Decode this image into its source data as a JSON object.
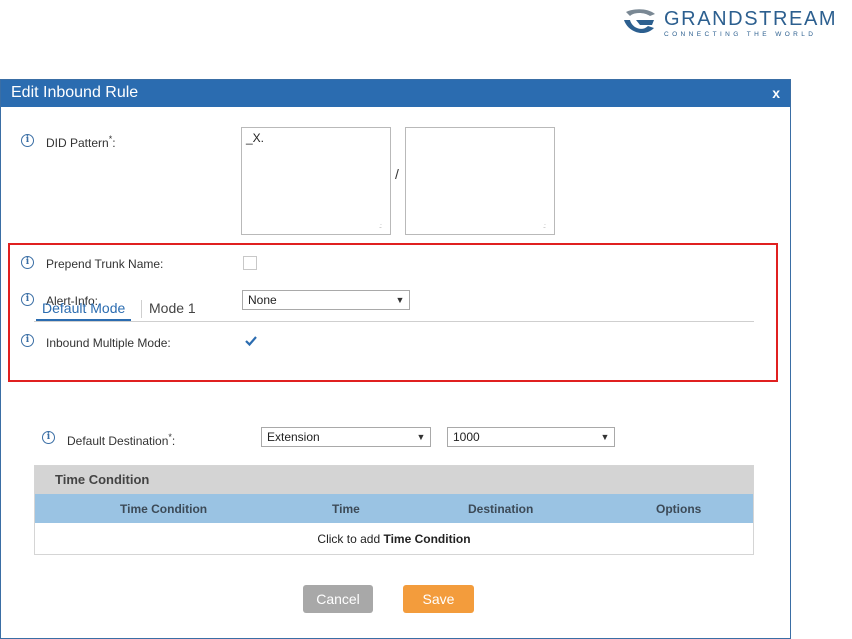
{
  "brand": {
    "name": "GRANDSTREAM",
    "tagline": "CONNECTING THE WORLD"
  },
  "dialog": {
    "title": "Edit Inbound Rule",
    "close_label": "x"
  },
  "form": {
    "did_pattern": {
      "label": "DID Pattern",
      "required_mark": "*",
      "colon": ":",
      "value": "_X.",
      "second_value": "",
      "separator": "/"
    },
    "prepend_trunk_name": {
      "label": "Prepend Trunk Name:",
      "checked": false
    },
    "alert_info": {
      "label": "Alert-Info:",
      "value": "None"
    },
    "inbound_multiple_mode": {
      "label": "Inbound Multiple Mode:",
      "checked": true
    },
    "tabs": [
      {
        "label": "Default Mode",
        "active": true
      },
      {
        "label": "Mode 1",
        "active": false
      }
    ],
    "default_destination": {
      "label": "Default Destination",
      "required_mark": "*",
      "colon": ":",
      "type_value": "Extension",
      "target_value": "1000"
    }
  },
  "time_condition": {
    "title": "Time Condition",
    "columns": [
      "Time Condition",
      "Time",
      "Destination",
      "Options"
    ],
    "add_prefix": "Click to add ",
    "add_bold": "Time Condition"
  },
  "buttons": {
    "cancel": "Cancel",
    "save": "Save"
  },
  "colors": {
    "titlebar": "#2b6cb0",
    "highlight_border": "#e02020",
    "save_button": "#f39c3c",
    "cancel_button": "#a8a8a8",
    "table_header": "#9ac3e3"
  },
  "icons": [
    "info-icon",
    "dropdown-arrow-icon",
    "checkmark-icon",
    "close-icon",
    "grandstream-logo-icon"
  ]
}
